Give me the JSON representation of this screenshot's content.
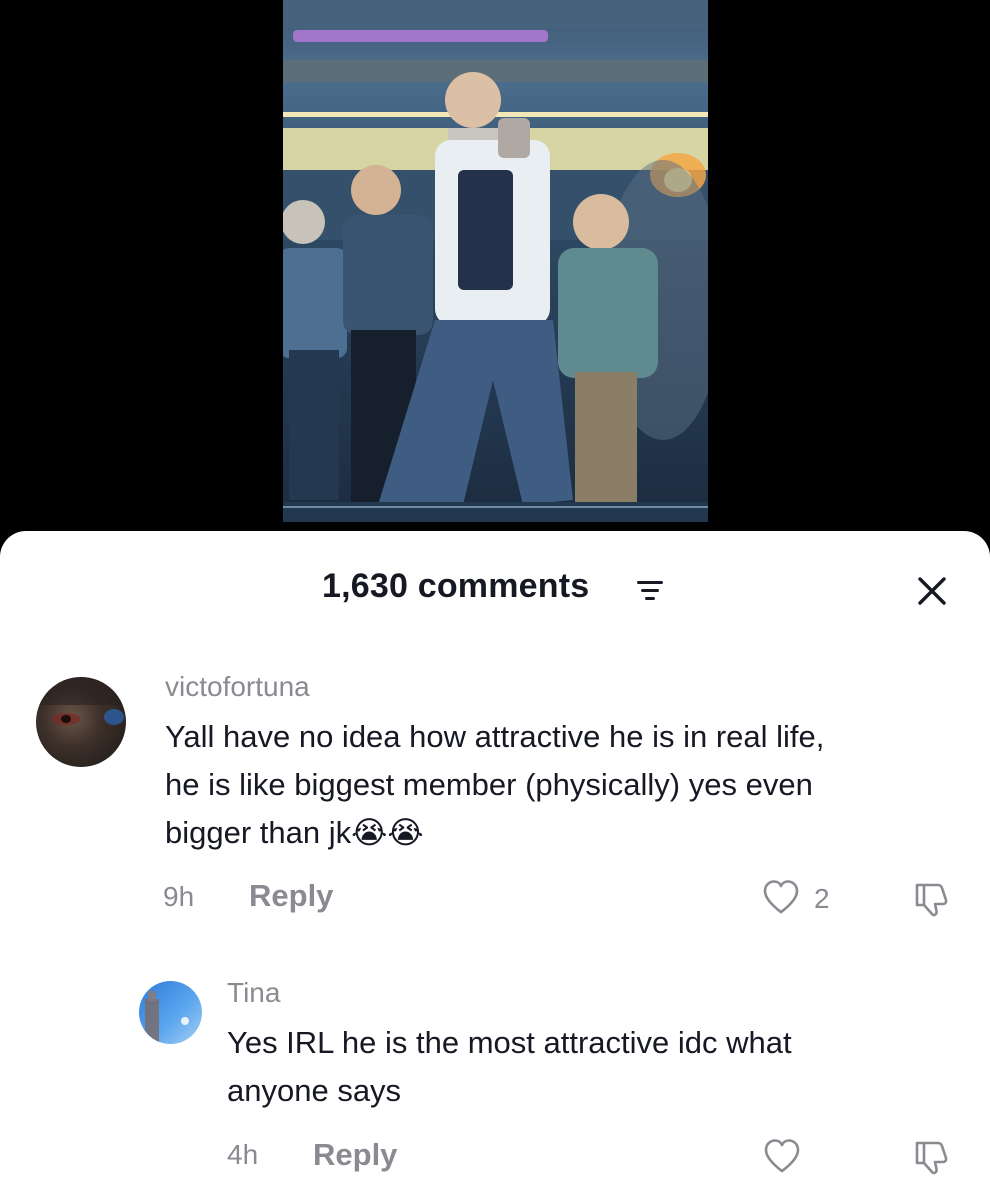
{
  "comments_sheet": {
    "count_label": "1,630 comments",
    "comments": [
      {
        "username": "victofortuna",
        "lines": [
          "Yall have no idea how attractive he is in real life,",
          "he is like biggest member (physically) yes even",
          "bigger than jk😭😭"
        ],
        "time": "9h",
        "reply_label": "Reply",
        "likes": "2"
      },
      {
        "username": "Tina",
        "lines": [
          "Yes IRL he is the most attractive idc what",
          "anyone says"
        ],
        "time": "4h",
        "reply_label": "Reply",
        "likes": ""
      }
    ]
  },
  "icons": {
    "sort": "sort-icon",
    "close": "close-icon",
    "like": "heart-icon",
    "dislike": "thumbs-down-icon"
  },
  "colors": {
    "text_primary": "#161823",
    "text_secondary": "#8a8b91",
    "sheet_background": "#ffffff",
    "page_background": "#000000"
  }
}
